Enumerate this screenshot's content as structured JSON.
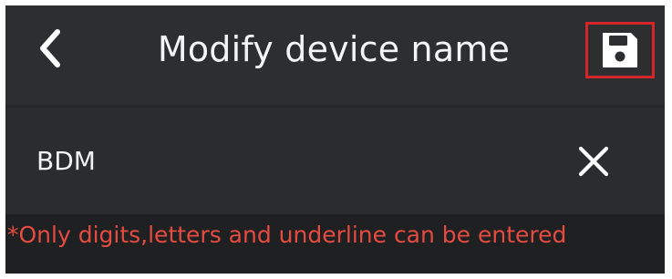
{
  "header": {
    "title": "Modify device name",
    "back_icon": "chevron-left-icon",
    "save_icon": "save-icon",
    "highlight_color": "#d2262a"
  },
  "device": {
    "name": "BDM",
    "clear_icon": "close-icon"
  },
  "hint": {
    "text": "*Only digits,letters and underline can be entered",
    "color": "#e54b40"
  }
}
